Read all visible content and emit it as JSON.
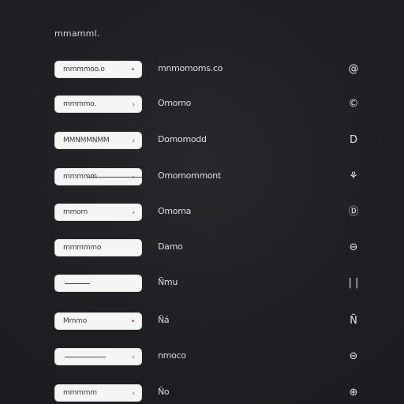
{
  "title": "mmamml.",
  "rows": [
    {
      "input": "mmmmoo.o",
      "indicator": "•",
      "label": "mnmomoms.co",
      "icon": "@",
      "icon_name": "at-icon"
    },
    {
      "input": "mmmmo.",
      "indicator": "›",
      "label": "Omomo",
      "icon": "©",
      "icon_name": "circle-icon"
    },
    {
      "input": "MMNMMNMM",
      "indicator": "›",
      "label": "Domomodd",
      "icon": "D",
      "icon_name": "d-icon"
    },
    {
      "input": "mmmmm",
      "indicator": "›",
      "label": "Omomommont",
      "icon": "⚘",
      "icon_name": "sprout-icon"
    },
    {
      "input": "mmom",
      "indicator": "›",
      "label": "Omoma",
      "icon": "Ⓓ",
      "icon_name": "circle-letter-icon"
    },
    {
      "input": "mmmmmo",
      "indicator": "",
      "label": "Damo",
      "icon": "⊖",
      "icon_name": "minus-circle-icon"
    },
    {
      "input": "",
      "indicator": "",
      "label": "Ñmu",
      "icon": "| |",
      "icon_name": "pause-icon"
    },
    {
      "input": "Mmmo",
      "indicator": "•",
      "label": "Ñá",
      "icon": "Ñ",
      "icon_name": "n-icon"
    },
    {
      "input": "",
      "indicator": "›",
      "label": "nmoco",
      "icon": "⊖",
      "icon_name": "minus-circle-icon"
    },
    {
      "input": "mmmmm",
      "indicator": "›",
      "label": "Ño",
      "icon": "⊕",
      "icon_name": "plus-circle-icon"
    }
  ]
}
